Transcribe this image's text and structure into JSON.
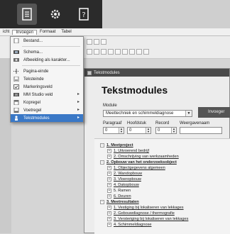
{
  "menubar": {
    "items": [
      "icht",
      "Invoegen",
      "Formaat",
      "Tabel"
    ],
    "open_index": 1
  },
  "dropdown": {
    "items": [
      {
        "label": "Bestand...",
        "icon": "file-icon",
        "submenu": false
      },
      {
        "label": "Schema...",
        "icon": "schema-icon",
        "submenu": false
      },
      {
        "label": "Afbeelding als karakter...",
        "icon": "image-char-icon",
        "submenu": false
      },
      {
        "label": "Pagina-einde",
        "icon": "page-break-icon",
        "submenu": false
      },
      {
        "label": "Teksteinde",
        "icon": "text-end-icon",
        "submenu": false
      },
      {
        "label": "Markeringsveld",
        "icon": "marker-field-icon",
        "submenu": false
      },
      {
        "label": "MM Studio veld",
        "icon": "studio-field-icon",
        "submenu": true
      },
      {
        "label": "Kopregel",
        "icon": "header-icon",
        "submenu": true
      },
      {
        "label": "Voetregel",
        "icon": "footer-icon",
        "submenu": true
      },
      {
        "label": "Tekstmodules",
        "icon": "text-modules-icon",
        "submenu": true
      }
    ],
    "selected_index": 9
  },
  "dialog": {
    "window_title": "Tekstmodules",
    "heading": "Tekstmodules",
    "module_label": "Module",
    "module_value": "Meettechniek en schimmeldiagnose",
    "invoegen_label": "Invoeger",
    "fields": [
      {
        "label": "Paragraaf",
        "value": "0"
      },
      {
        "label": "Hoofdstuk",
        "value": "0"
      },
      {
        "label": "Record",
        "value": "0"
      },
      {
        "label": "Weergavenaam",
        "value": ""
      }
    ],
    "tree": [
      {
        "level": 0,
        "text": "1. Meetproject",
        "style": "bold"
      },
      {
        "level": 1,
        "text": "1. Uitvoerend bedrijf",
        "style": "link"
      },
      {
        "level": 1,
        "text": "2. Omschrijving van werkzaamheden",
        "style": "link"
      },
      {
        "level": 0,
        "text": "2. Opbouw van het onderzoeksobject",
        "style": "bold"
      },
      {
        "level": 1,
        "text": "1. Objectgegevens algemeen",
        "style": "link"
      },
      {
        "level": 1,
        "text": "2. Wandopbouw",
        "style": "link"
      },
      {
        "level": 1,
        "text": "3. Vloeropbouw",
        "style": "link"
      },
      {
        "level": 1,
        "text": "4. Dakopbouw",
        "style": "link"
      },
      {
        "level": 1,
        "text": "5. Ramen",
        "style": "plain"
      },
      {
        "level": 1,
        "text": "6. Deuren",
        "style": "link"
      },
      {
        "level": 0,
        "text": "3. Meetresultaten",
        "style": "bold"
      },
      {
        "level": 1,
        "text": "1. Vestiging bij lokaliseren van lekkages",
        "style": "link"
      },
      {
        "level": 1,
        "text": "2. Gebouwdiagnose / thermografie",
        "style": "link"
      },
      {
        "level": 1,
        "text": "3. Versteriging bij lokaliseren van lekkages",
        "style": "link"
      },
      {
        "level": 1,
        "text": "4. Schimmeldiagnose",
        "style": "link"
      }
    ]
  },
  "colors": {
    "accent": "#3a78c6",
    "topbar": "#2b2b2b"
  }
}
